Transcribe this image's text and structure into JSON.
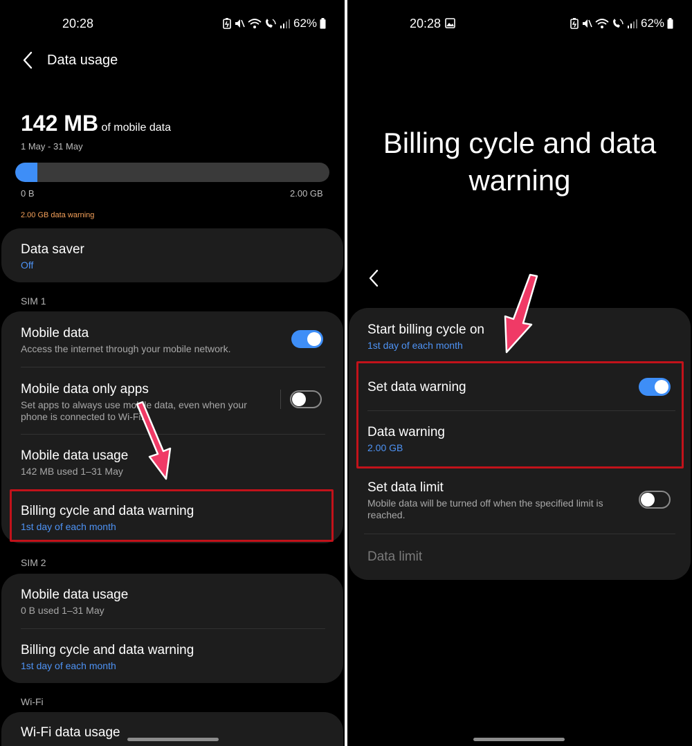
{
  "status_bar": {
    "time": "20:28",
    "battery": "62%",
    "icons": [
      "battery-saver-icon",
      "mute-icon",
      "wifi-call-icon",
      "volte-icon",
      "signal-icon",
      "battery-icon"
    ]
  },
  "left": {
    "header": {
      "title": "Data usage"
    },
    "usage": {
      "amount": "142 MB",
      "of_label": "of mobile data",
      "period": "1 May - 31 May",
      "fraction_used": 0.07,
      "min_label": "0 B",
      "max_label": "2.00 GB",
      "warning": "2.00 GB data warning"
    },
    "data_saver": {
      "title": "Data saver",
      "status": "Off"
    },
    "sim1": {
      "label": "SIM 1",
      "mobile_data": {
        "title": "Mobile data",
        "subtitle": "Access the internet through your mobile network.",
        "enabled": true
      },
      "only_apps": {
        "title": "Mobile data only apps",
        "subtitle": "Set apps to always use mobile data, even when your phone is connected to Wi-Fi.",
        "enabled": false
      },
      "usage": {
        "title": "Mobile data usage",
        "subtitle": "142 MB used 1–31 May"
      },
      "billing": {
        "title": "Billing cycle and data warning",
        "subtitle": "1st day of each month"
      }
    },
    "sim2": {
      "label": "SIM 2",
      "usage": {
        "title": "Mobile data usage",
        "subtitle": "0 B used 1–31 May"
      },
      "billing": {
        "title": "Billing cycle and data warning",
        "subtitle": "1st day of each month"
      }
    },
    "wifi": {
      "label": "Wi-Fi",
      "usage": {
        "title": "Wi-Fi data usage"
      }
    }
  },
  "right": {
    "title_line1": "Billing cycle and data",
    "title_line2": "warning",
    "start_cycle": {
      "title": "Start billing cycle on",
      "subtitle": "1st day of each month"
    },
    "set_warning": {
      "title": "Set data warning",
      "enabled": true
    },
    "data_warning": {
      "title": "Data warning",
      "value": "2.00 GB"
    },
    "set_limit": {
      "title": "Set data limit",
      "subtitle": "Mobile data will be turned off when the specified limit is reached.",
      "enabled": false
    },
    "data_limit": {
      "title": "Data limit"
    }
  },
  "colors": {
    "background": "#000000",
    "card": "#1d1d1d",
    "accent": "#3e8ef7",
    "warning": "#f5a15a",
    "highlight": "#c2121a",
    "annotation_arrow": "#f03a66"
  }
}
